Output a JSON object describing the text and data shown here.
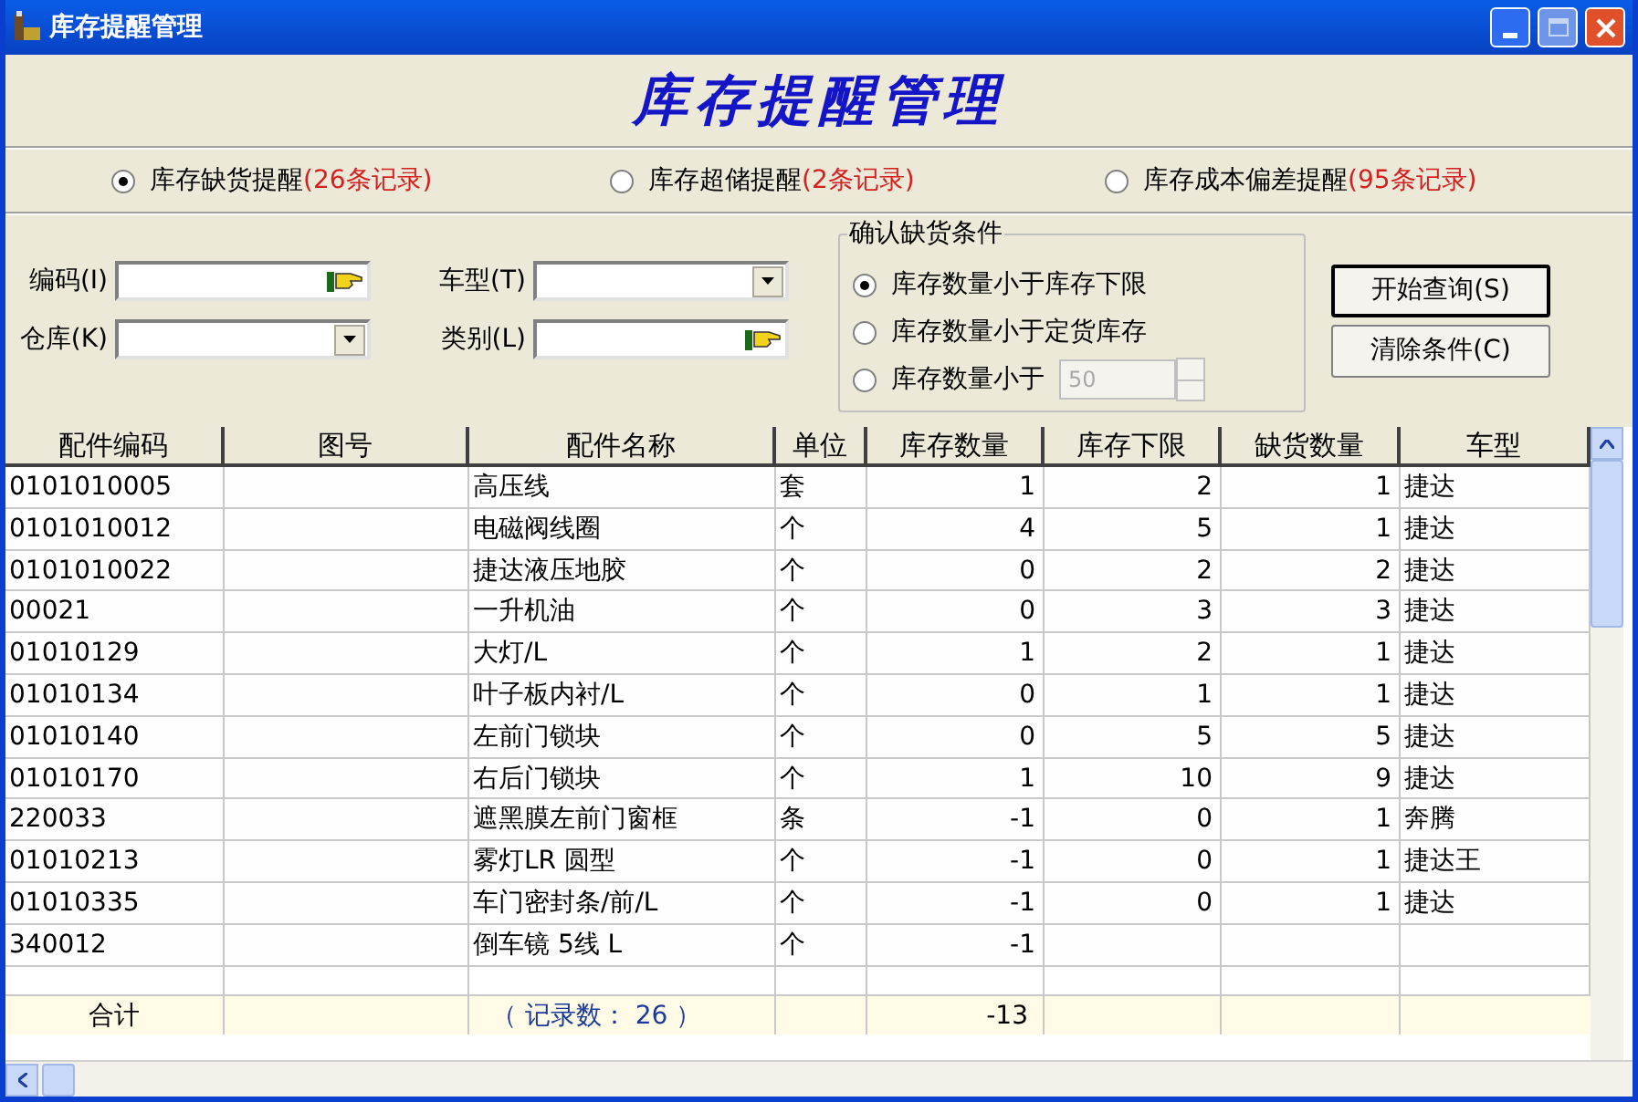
{
  "window": {
    "title": "库存提醒管理"
  },
  "heading": "库存提醒管理",
  "modes": [
    {
      "label": "库存缺货提醒",
      "count": "(26条记录)",
      "selected": true
    },
    {
      "label": "库存超储提醒",
      "count": "(2条记录)",
      "selected": false
    },
    {
      "label": "库存成本偏差提醒",
      "count": "(95条记录)",
      "selected": false
    }
  ],
  "filters": [
    {
      "label": "编码(I)",
      "kind": "lookup"
    },
    {
      "label": "车型(T)",
      "kind": "dropdown"
    },
    {
      "label": "仓库(K)",
      "kind": "dropdown"
    },
    {
      "label": "类别(L)",
      "kind": "lookup"
    }
  ],
  "conditions": {
    "title": "确认缺货条件",
    "options": [
      {
        "label": "库存数量小于库存下限",
        "selected": true
      },
      {
        "label": "库存数量小于定货库存",
        "selected": false
      },
      {
        "label": "库存数量小于",
        "selected": false,
        "value": "50",
        "disabled": true
      }
    ]
  },
  "buttons": [
    "开始查询(S)",
    "清除条件(C)"
  ],
  "table": {
    "columns": [
      "配件编码",
      "图号",
      "配件名称",
      "单位",
      "库存数量",
      "库存下限",
      "缺货数量",
      "车型"
    ],
    "rows": [
      {
        "code": "0101010005",
        "name": "高压线",
        "unit": "套",
        "qty": "1",
        "min": "2",
        "short": "1",
        "model": "捷达"
      },
      {
        "code": "0101010012",
        "name": "电磁阀线圈",
        "unit": "个",
        "qty": "4",
        "min": "5",
        "short": "1",
        "model": "捷达"
      },
      {
        "code": "0101010022",
        "name": "捷达液压地胶",
        "unit": "个",
        "qty": "0",
        "min": "2",
        "short": "2",
        "model": "捷达"
      },
      {
        "code": "00021",
        "name": "一升机油",
        "unit": "个",
        "qty": "0",
        "min": "3",
        "short": "3",
        "model": "捷达"
      },
      {
        "code": "01010129",
        "name": "大灯/L",
        "unit": "个",
        "qty": "1",
        "min": "2",
        "short": "1",
        "model": "捷达"
      },
      {
        "code": "01010134",
        "name": "叶子板内衬/L",
        "unit": "个",
        "qty": "0",
        "min": "1",
        "short": "1",
        "model": "捷达"
      },
      {
        "code": "01010140",
        "name": "左前门锁块",
        "unit": "个",
        "qty": "0",
        "min": "5",
        "short": "5",
        "model": "捷达"
      },
      {
        "code": "01010170",
        "name": "右后门锁块",
        "unit": "个",
        "qty": "1",
        "min": "10",
        "short": "9",
        "model": "捷达"
      },
      {
        "code": "220033",
        "name": "遮黑膜左前门窗框",
        "unit": "条",
        "qty": "-1",
        "min": "0",
        "short": "1",
        "model": "奔腾"
      },
      {
        "code": "01010213",
        "name": "雾灯LR 圆型",
        "unit": "个",
        "qty": "-1",
        "min": "0",
        "short": "1",
        "model": "捷达王"
      },
      {
        "code": "01010335",
        "name": "车门密封条/前/L",
        "unit": "个",
        "qty": "-1",
        "min": "0",
        "short": "1",
        "model": "捷达"
      },
      {
        "code": "340012",
        "name": "倒车镜 5线 L",
        "unit": "个",
        "qty": "-1"
      }
    ],
    "total": {
      "label": "合计",
      "records": "（ 记录数： 26 ）",
      "qty": "-13"
    }
  }
}
